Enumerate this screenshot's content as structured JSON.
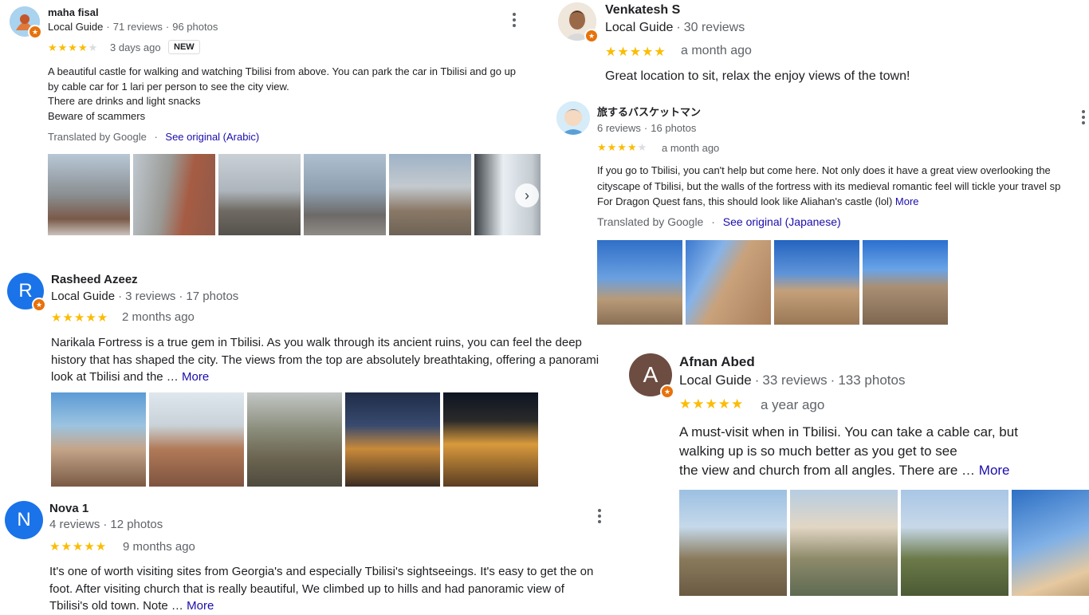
{
  "reviews": [
    {
      "name": "maha fisal",
      "role": "Local Guide",
      "reviews": "71 reviews",
      "photos": "96 photos",
      "stars": 4,
      "time": "3 days ago",
      "tag": "NEW",
      "text": [
        "A beautiful castle for walking and watching Tbilisi from above. You can park the car in Tbilisi and go up",
        "by cable car for 1 lari per person to see the city view.",
        "There are drinks and light snacks",
        "Beware of scammers"
      ],
      "translated": "Translated by Google",
      "see_original": "See original (Arabic)"
    },
    {
      "name": "Rasheed Azeez",
      "avatar_letter": "R",
      "role": "Local Guide",
      "reviews": "3 reviews",
      "photos": "17 photos",
      "stars": 5,
      "time": "2 months ago",
      "text": [
        "Narikala Fortress is a true gem in Tbilisi. As you walk through its ancient ruins, you can feel the deep",
        "history that has shaped the city. The views from the top are absolutely breathtaking, offering a panorami",
        "look at Tbilisi and the …"
      ],
      "more": "More"
    },
    {
      "name": "Nova 1",
      "avatar_letter": "N",
      "reviews": "4 reviews",
      "photos": "12 photos",
      "stars": 5,
      "time": "9 months ago",
      "text": [
        "It's one of worth visiting sites from  Georgia's and especially Tbilisi's sightseeings. It's easy to get the on",
        "foot. After visiting church that is really beautiful, We climbed up to hills and had panoramic view of",
        "Tbilisi's old town. Note …"
      ],
      "more": "More"
    },
    {
      "name": "Venkatesh S",
      "role": "Local Guide",
      "reviews": "30 reviews",
      "stars": 5,
      "time": "a month ago",
      "text": [
        "Great location to sit, relax the enjoy views of the town!"
      ]
    },
    {
      "name": "旅するバスケットマン",
      "reviews": "6 reviews",
      "photos": "16 photos",
      "stars": 4,
      "time": "a month ago",
      "text": [
        "If you go to Tbilisi, you can't help but come here. Not only does it have a great view overlooking the",
        "cityscape of Tbilisi, but the walls of the fortress with its medieval romantic feel will tickle your travel sp",
        "For Dragon Quest fans, this should look like Aliahan's castle (lol)"
      ],
      "more": "More",
      "translated": "Translated by Google",
      "see_original": "See original (Japanese)"
    },
    {
      "name": "Afnan Abed",
      "avatar_letter": "A",
      "role": "Local Guide",
      "reviews": "33 reviews",
      "photos": "133 photos",
      "stars": 5,
      "time": "a year ago",
      "text": [
        "A must-visit when in Tbilisi. You can take a cable car, but",
        "walking up is so much better as you get to see",
        "the view and church from all angles. There are …"
      ],
      "more": "More"
    }
  ],
  "colors": {
    "star": "#fbbc04",
    "link": "#1a0dab",
    "guide_badge": "#e8710a",
    "avatar_r": "#1a73e8",
    "avatar_n": "#1a73e8",
    "avatar_a": "#6d4c41"
  },
  "icons": {
    "kebab": "more-vert-icon",
    "next": "chevron-right-icon",
    "badge": "local-guide-star-icon"
  }
}
